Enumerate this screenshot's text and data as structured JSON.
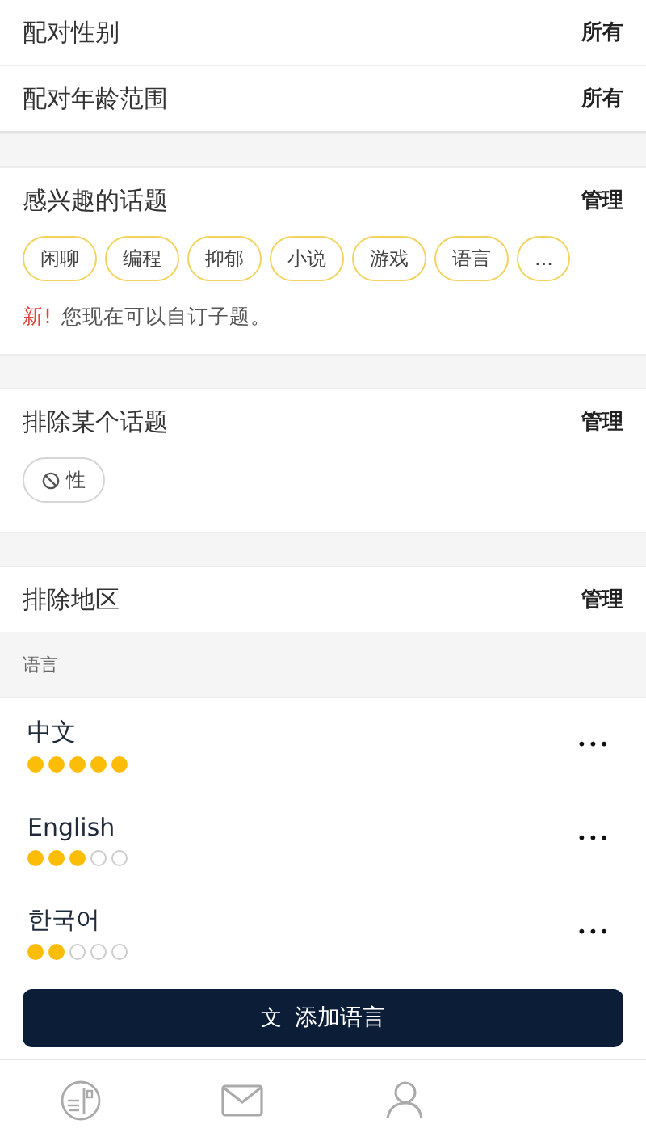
{
  "settings": [
    {
      "label": "配对性别",
      "value": "所有"
    },
    {
      "label": "配对年龄范围",
      "value": "所有"
    }
  ],
  "interests": {
    "title": "感兴趣的话题",
    "action": "管理",
    "topics": [
      "闲聊",
      "编程",
      "抑郁",
      "小说",
      "游戏",
      "语言",
      "..."
    ],
    "notice_tag": "新!",
    "notice": "您现在可以自订子题。"
  },
  "excluded_topics": {
    "title": "排除某个话题",
    "action": "管理",
    "topics": [
      "性"
    ]
  },
  "excluded_regions": {
    "title": "排除地区",
    "action": "管理"
  },
  "languages": {
    "header": "语言",
    "items": [
      {
        "name": "中文",
        "stars": 5,
        "menu": "•••"
      },
      {
        "name": "English",
        "stars": 3,
        "menu": "•••"
      },
      {
        "name": "한국어",
        "stars": 2,
        "menu": "•••"
      }
    ],
    "add_button": {
      "icon": "文",
      "label": "添加语言"
    }
  },
  "tab_bar": {
    "items": [
      {
        "kind": "card"
      },
      {
        "kind": "mail"
      },
      {
        "kind": "person"
      }
    ]
  }
}
